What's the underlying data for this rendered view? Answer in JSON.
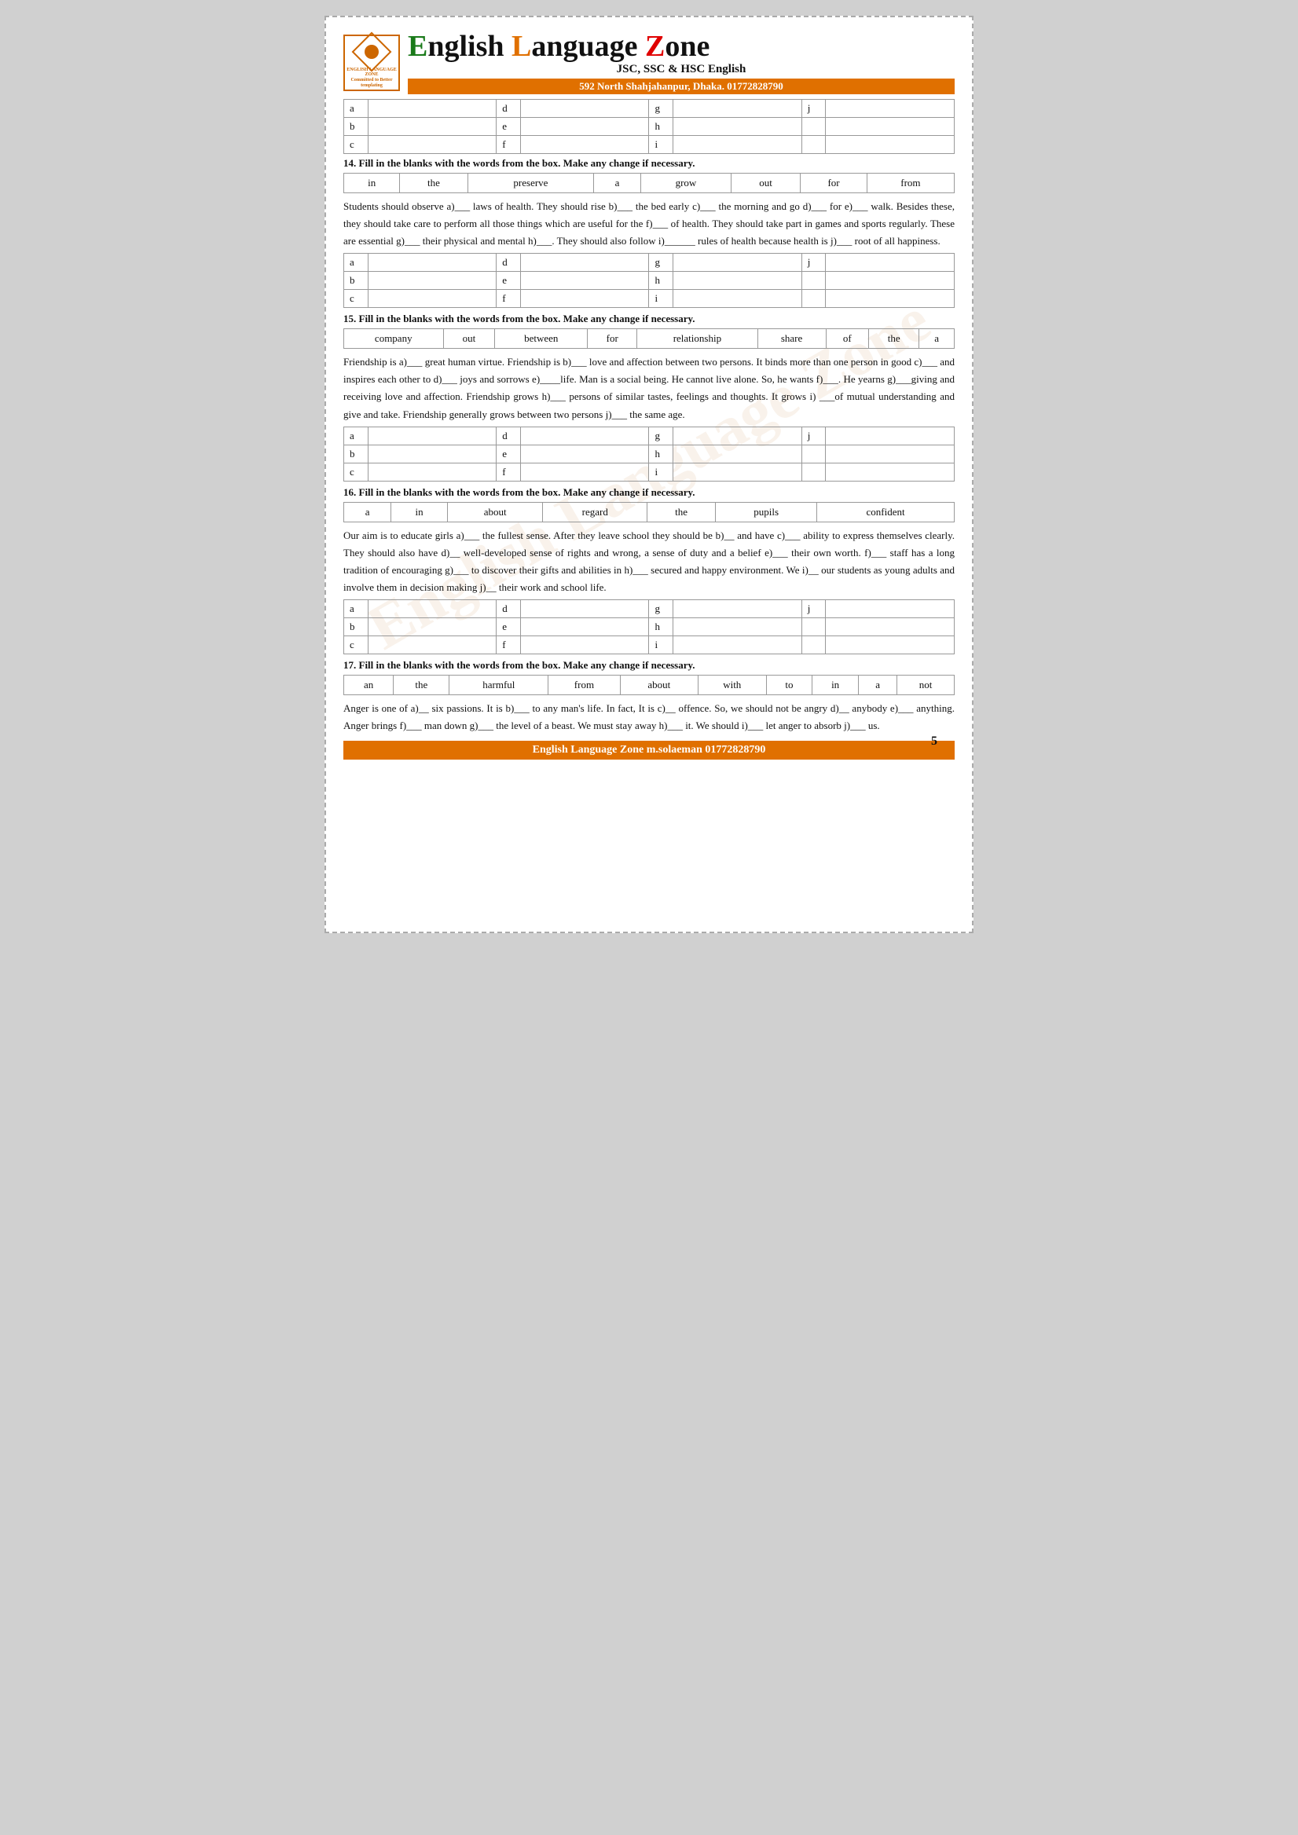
{
  "header": {
    "title": "English Language Zone",
    "sub": "JSC, SSC & HSC  English",
    "address": "592 North Shahjahanpur, Dhaka. 01772828790",
    "logo_label": "ENGLISH LANGUAGE ZONE\nCommitted to Better templating"
  },
  "watermark": "English Language Zone",
  "q14": {
    "instruction": "14. Fill in the blanks with the words from the box. Make any change if necessary.",
    "words": [
      "in",
      "the",
      "preserve",
      "a",
      "grow",
      "out",
      "for",
      "from"
    ],
    "para": "Students should observe a)___ laws of health. They should rise b)___ the bed early c)___ the morning and go d)___ for e)___ walk. Besides these, they should take care to perform all those things which are useful for the f)___ of health. They should take part in games and sports regularly. These are essential g)___ their physical and mental h)___. They should also follow i)______ rules of health because health is j)___ root of all happiness."
  },
  "q15": {
    "instruction": "15.  Fill in the blanks with the words from the box. Make any change if necessary.",
    "words": [
      "company",
      "out",
      "between",
      "for",
      "relationship",
      "share",
      "of",
      "the",
      "a"
    ],
    "para": "Friendship is a)___ great human virtue. Friendship is b)___ love and affection between two persons. It binds more than one person in good c)___ and inspires each other to d)___ joys and sorrows e)____life. Man is a social being. He cannot live alone. So, he wants f)___. He yearns g)___giving and receiving love and affection. Friendship grows h)___ persons of similar tastes, feelings and thoughts. It grows i) ___of mutual understanding and give and take. Friendship generally grows between two persons j)___ the same age."
  },
  "q16": {
    "instruction": "16.  Fill in the blanks with the words from the box. Make any change if necessary.",
    "words": [
      "a",
      "in",
      "about",
      "regard",
      "the",
      "pupils",
      "confident"
    ],
    "para": "Our aim is to educate girls a)___ the fullest sense. After they leave school they should be b)__ and have c)___ ability to express themselves clearly. They should also have d)__ well-developed sense of rights and wrong, a sense of duty and a belief e)___ their own worth. f)___ staff has a long tradition of encouraging g)___ to discover their gifts and abilities in h)___ secured and happy environment. We i)__ our students as young adults and involve them in decision making j)__ their work and school life."
  },
  "q17": {
    "instruction": "17.  Fill in the blanks with the words from the box. Make any change if necessary.",
    "words": [
      "an",
      "the",
      "harmful",
      "from",
      "about",
      "with",
      "to",
      "in",
      "a",
      "not"
    ],
    "para": "Anger is one of a)__ six passions. It is b)___ to any man's life. In fact, It is c)__ offence. So, we should not be angry d)__ anybody e)___ anything. Anger brings f)___ man down g)___ the level of a beast. We must stay away h)___ it. We should i)___ let anger to absorb j)___ us."
  },
  "footer": {
    "text": "English Language Zone  m.solaeman 01772828790"
  },
  "page_num": "5",
  "answer_labels": {
    "a": "a",
    "b": "b",
    "c": "c",
    "d": "d",
    "e": "e",
    "f": "f",
    "g": "g",
    "h": "h",
    "i": "i",
    "j": "j"
  }
}
